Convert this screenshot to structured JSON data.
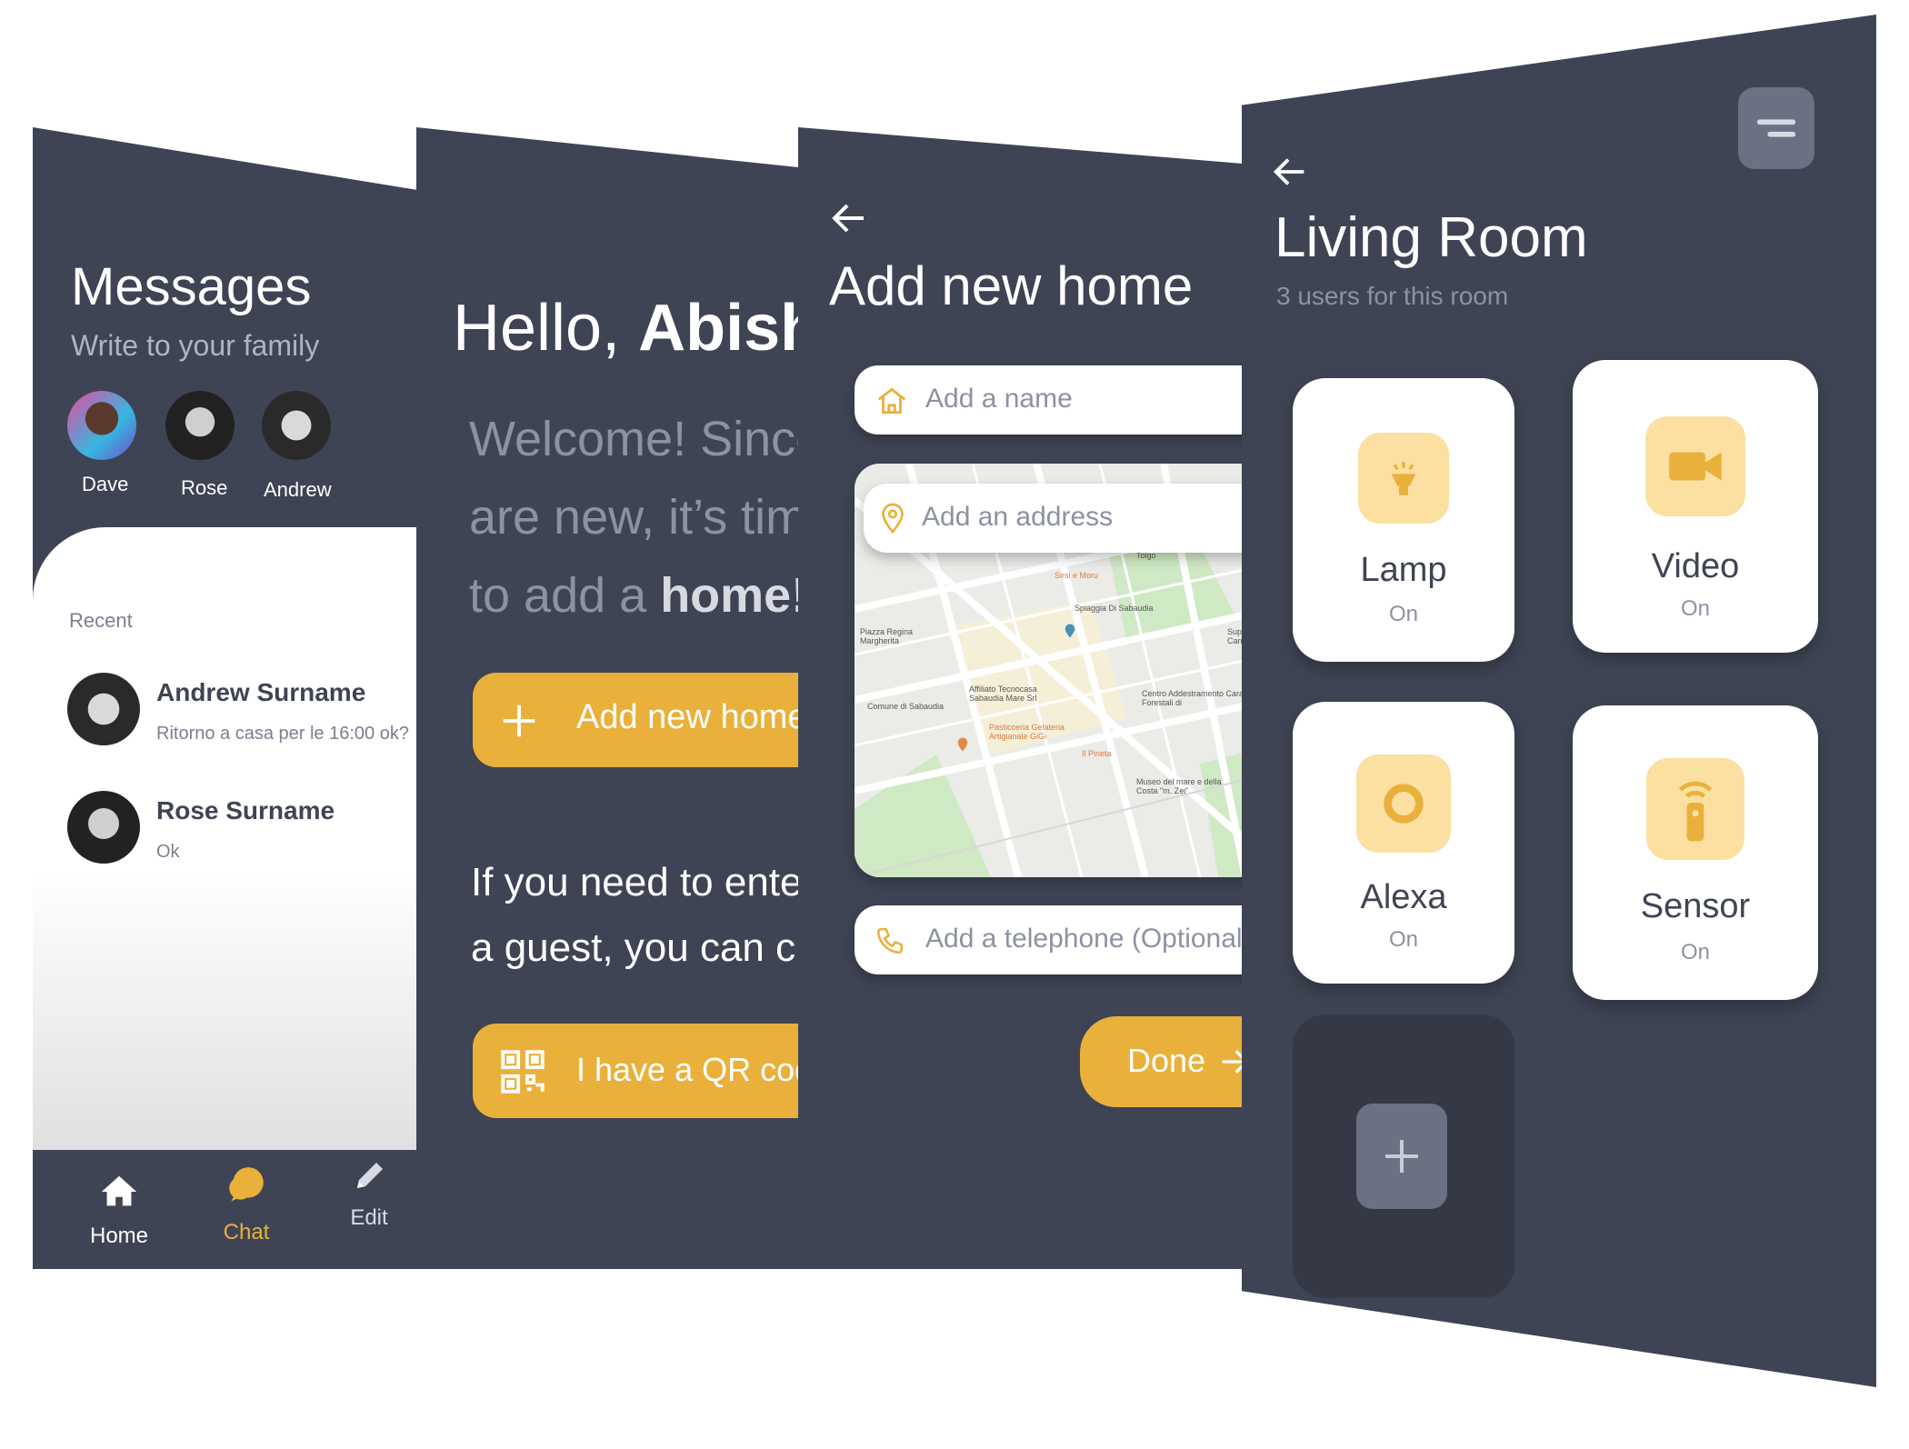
{
  "messages_screen": {
    "title": "Messages",
    "subtitle": "Write to your family",
    "contacts": [
      {
        "name": "Dave"
      },
      {
        "name": "Rose"
      },
      {
        "name": "Andrew"
      }
    ],
    "recent_label": "Recent",
    "conversations": [
      {
        "name": "Andrew Surname",
        "preview": "Ritorno a casa per le 16:00 ok?"
      },
      {
        "name": "Rose Surname",
        "preview": "Ok"
      }
    ],
    "nav": [
      {
        "label": "Home",
        "icon": "home-icon",
        "active": false
      },
      {
        "label": "Chat",
        "icon": "chat-icon",
        "active": true
      },
      {
        "label": "Edit",
        "icon": "pencil-icon",
        "active": false
      }
    ]
  },
  "hello_screen": {
    "greeting_prefix": "Hello, ",
    "greeting_name": "Abishe",
    "welcome_line1": "Welcome! Since",
    "welcome_line2": "are new, it’s tim",
    "welcome_line3_prefix": "to add a ",
    "welcome_line3_bold": "home!",
    "add_home_button": "Add new home",
    "guest_line1": "If you need to ente",
    "guest_line2": "a guest, you can ch",
    "qr_button": "I have a QR code"
  },
  "add_home_screen": {
    "title": "Add new home",
    "name_placeholder": "Add a name",
    "address_placeholder": "Add an address",
    "phone_placeholder": "Add a telephone (Optional)",
    "done_button": "Done",
    "map_labels": [
      "Piazza Regina Margherita",
      "Comune di Sabaudia",
      "Affiliato Tecnocasa Sabaudia Mare Srl",
      "Pasticceria Gelateria Artigianale GiGi",
      "Spiaggia Di Sabaudia",
      "Sirsi e Moru",
      "Centro Addestramento Carabinieri Forestali di",
      "Il Pineta",
      "Museo del mare e della Costa \"m. Zei\"",
      "Largo Giuseppe Tolgo",
      "Super Carrefour"
    ]
  },
  "room_screen": {
    "title": "Living Room",
    "subtitle": "3 users for this room",
    "devices": [
      {
        "name": "Lamp",
        "state": "On",
        "icon": "lamp-icon"
      },
      {
        "name": "Video",
        "state": "On",
        "icon": "video-camera-icon"
      },
      {
        "name": "Alexa",
        "state": "On",
        "icon": "alexa-ring-icon"
      },
      {
        "name": "Sensor",
        "state": "On",
        "icon": "sensor-icon"
      }
    ],
    "add_device_icon": "plus-icon",
    "menu_icon": "menu-icon"
  },
  "colors": {
    "dark_bg": "#3f4454",
    "accent": "#e9b13b",
    "icon_bg": "#fbe0a2",
    "muted_text": "#8d92a2"
  }
}
